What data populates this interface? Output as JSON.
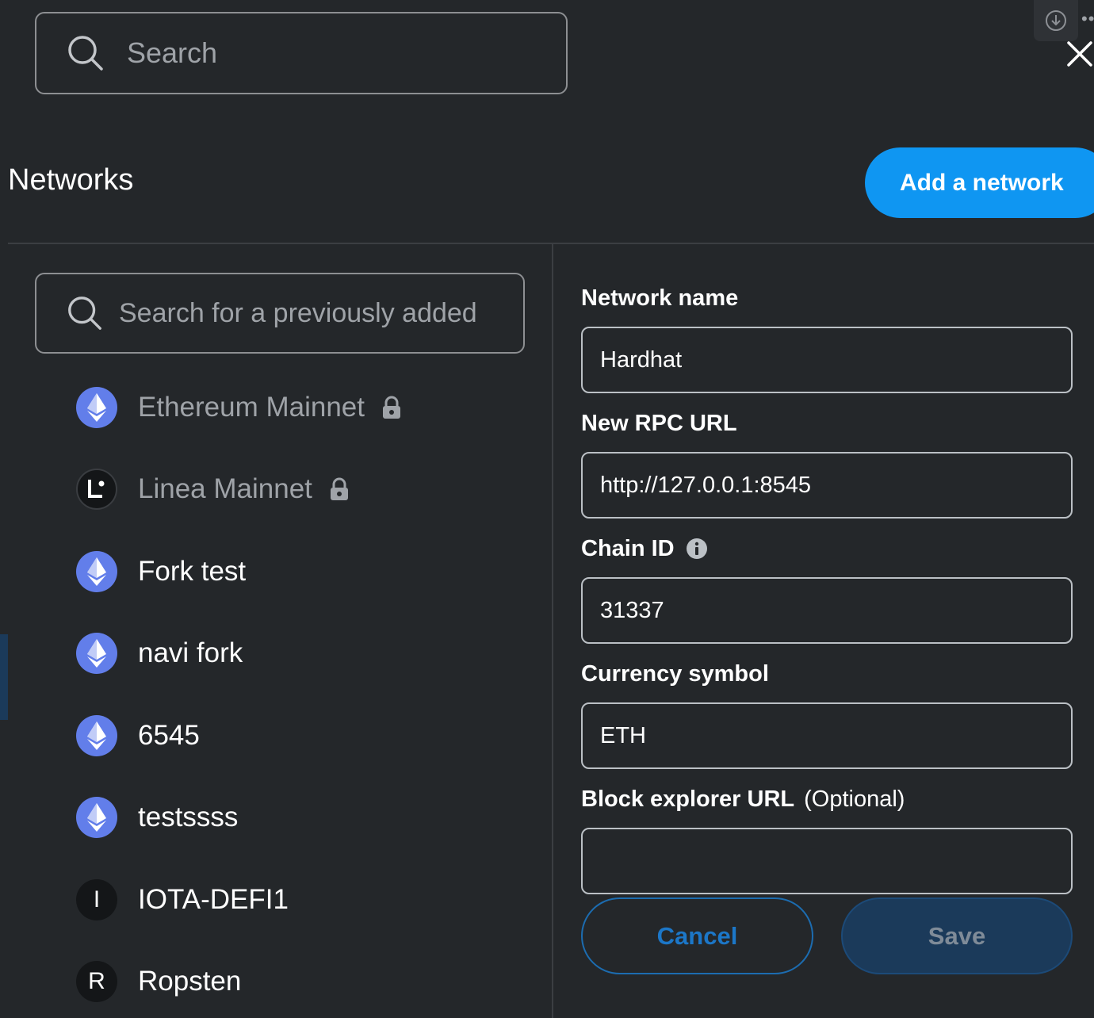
{
  "search": {
    "placeholder": "Search"
  },
  "header": {
    "title": "Networks",
    "add_network_label": "Add a network"
  },
  "list_search": {
    "placeholder": "Search for a previously added"
  },
  "networks": [
    {
      "name": "Ethereum Mainnet",
      "icon": "ethereum-icon",
      "locked": true
    },
    {
      "name": "Linea Mainnet",
      "icon": "linea-icon",
      "locked": true
    },
    {
      "name": "Fork test",
      "icon": "ethereum-icon",
      "locked": false
    },
    {
      "name": "navi fork",
      "icon": "ethereum-icon",
      "locked": false
    },
    {
      "name": "6545",
      "icon": "ethereum-icon",
      "locked": false
    },
    {
      "name": "testssss",
      "icon": "ethereum-icon",
      "locked": false
    },
    {
      "name": "IOTA-DEFI1",
      "icon": "letter-icon",
      "letter": "I",
      "locked": false
    },
    {
      "name": "Ropsten",
      "icon": "letter-icon",
      "letter": "R",
      "locked": false
    }
  ],
  "form": {
    "network_name_label": "Network name",
    "network_name_value": "Hardhat",
    "rpc_url_label": "New RPC URL",
    "rpc_url_value": "http://127.0.0.1:8545",
    "chain_id_label": "Chain ID",
    "chain_id_value": "31337",
    "currency_symbol_label": "Currency symbol",
    "currency_symbol_value": "ETH",
    "block_explorer_label": "Block explorer URL",
    "block_explorer_optional": "(Optional)",
    "block_explorer_value": "",
    "cancel_label": "Cancel",
    "save_label": "Save"
  },
  "colors": {
    "background": "#24272a",
    "accent": "#0f96f2",
    "ethereum": "#627eea"
  }
}
